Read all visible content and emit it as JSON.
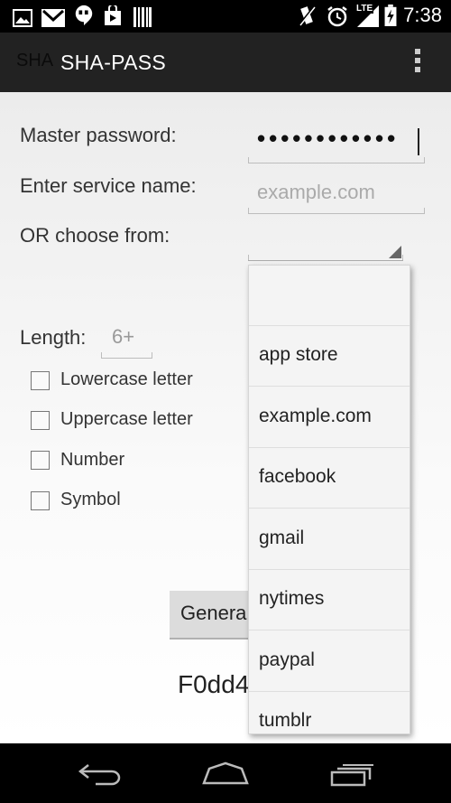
{
  "status_bar": {
    "time": "7:38",
    "left_icons": [
      "gallery-icon",
      "gmail-icon",
      "hangouts-icon",
      "play-store-icon",
      "barcode-icon"
    ],
    "right_icons": [
      "vibrate-icon",
      "alarm-icon",
      "lte-signal-icon",
      "battery-charging-icon"
    ],
    "network_label": "LTE"
  },
  "action_bar": {
    "app_icon_text": "SHA",
    "title": "SHA-PASS",
    "overflow_icon": "more-vert-icon"
  },
  "form": {
    "master_password_label": "Master password:",
    "master_password_value": "••••••••••••",
    "service_name_label": "Enter service name:",
    "service_name_placeholder": "example.com",
    "choose_label": "OR choose from:",
    "length_label": "Length:",
    "length_placeholder": "6+",
    "checkboxes": [
      {
        "label": "Lowercase letter",
        "checked": false
      },
      {
        "label": "Uppercase letter",
        "checked": false
      },
      {
        "label": "Number",
        "checked": false
      },
      {
        "label": "Symbol",
        "checked": false
      }
    ],
    "generate_label": "Genera",
    "result_text": "F0dd4"
  },
  "dropdown": {
    "items": [
      "",
      "app store",
      "example.com",
      "facebook",
      "gmail",
      "nytimes",
      "paypal",
      "tumblr"
    ]
  },
  "nav_bar": {
    "icons": [
      "back-icon",
      "home-icon",
      "recents-icon"
    ]
  },
  "colors": {
    "status_bar": "#000000",
    "action_bar": "#222222",
    "content_bg": "#f2f2f2",
    "popup_bg": "#f4f4f4"
  }
}
